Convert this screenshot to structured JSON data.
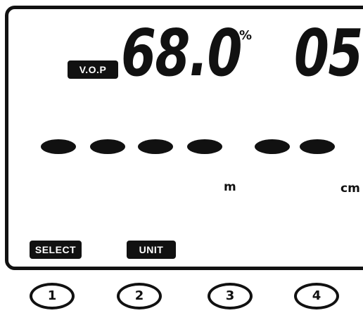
{
  "display": {
    "mode_badge": "V.O.P",
    "main_value": "68.0",
    "main_unit": "%",
    "secondary_value": "05",
    "dash_row_count": 6,
    "unit_m": "m",
    "unit_cm": "cm"
  },
  "softkeys": {
    "select_label": "SELECT",
    "unit_label": "UNIT"
  },
  "buttons": [
    {
      "label": "1"
    },
    {
      "label": "2"
    },
    {
      "label": "3"
    },
    {
      "label": "4"
    }
  ],
  "colors": {
    "lcd_ink": "#111111",
    "lcd_background": "#ffffff"
  }
}
